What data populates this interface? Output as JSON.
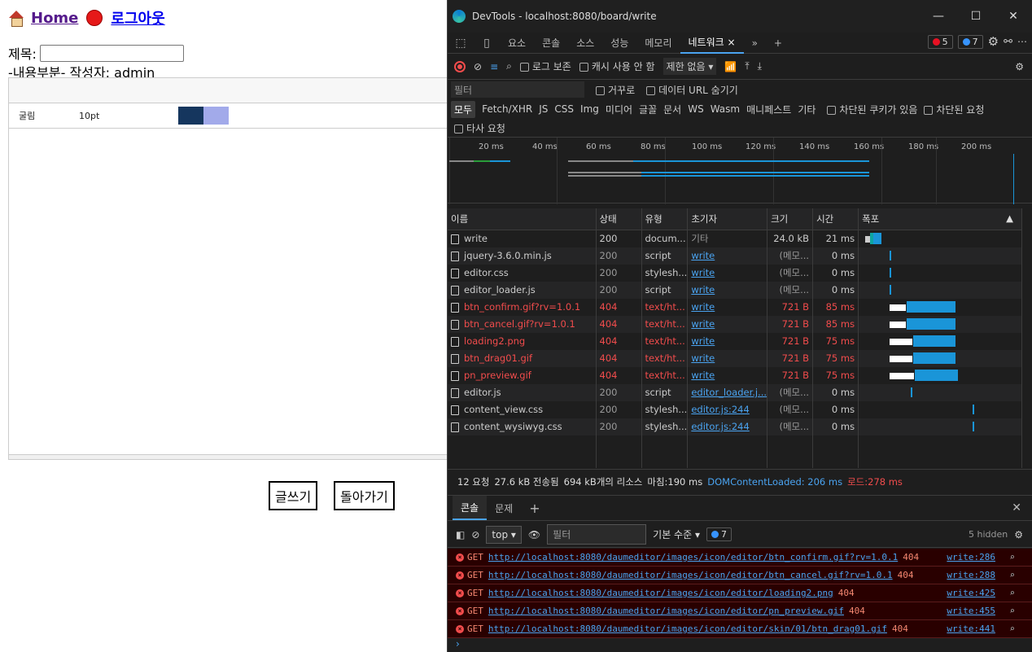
{
  "page": {
    "nav": {
      "home_label": "Home",
      "logout_label": "로그아웃"
    },
    "title_label": "제목:",
    "content_line": "-내용부분- 작성자: admin",
    "editor": {
      "font_name": "굴림",
      "font_size": "10pt"
    },
    "buttons": {
      "write": "글쓰기",
      "back": "돌아가기"
    }
  },
  "devtools": {
    "window_title": "DevTools - localhost:8080/board/write",
    "tabs": [
      "요소",
      "콘솔",
      "소스",
      "성능",
      "메모리",
      "네트워크"
    ],
    "badge_errors": "5",
    "badge_messages": "7",
    "toolbar": {
      "preserve_log": "로그 보존",
      "disable_cache": "캐시 사용 안 함",
      "throttle": "제한 없음"
    },
    "filter": {
      "placeholder": "필터",
      "invert": "거꾸로",
      "hide_data_urls": "데이터 URL 숨기기"
    },
    "type_filters": [
      "모두",
      "Fetch/XHR",
      "JS",
      "CSS",
      "Img",
      "미디어",
      "글꼴",
      "문서",
      "WS",
      "Wasm",
      "매니페스트",
      "기타"
    ],
    "blocked_cookies": "차단된 쿠키가 있음",
    "blocked_requests": "차단된 요청",
    "third_party": "타사 요청",
    "overview_ticks": [
      "20 ms",
      "40 ms",
      "60 ms",
      "80 ms",
      "100 ms",
      "120 ms",
      "140 ms",
      "160 ms",
      "180 ms",
      "200 ms"
    ],
    "columns": [
      "이름",
      "상태",
      "유형",
      "초기자",
      "크기",
      "시간",
      "폭포"
    ],
    "requests": [
      {
        "name": "write",
        "status": "200",
        "type": "docum...",
        "initiator": "기타",
        "size": "24.0 kB",
        "time": "21 ms",
        "error": false
      },
      {
        "name": "jquery-3.6.0.min.js",
        "status": "200",
        "type": "script",
        "initiator": "write",
        "size": "(메모...",
        "time": "0 ms",
        "error": false
      },
      {
        "name": "editor.css",
        "status": "200",
        "type": "stylesh...",
        "initiator": "write",
        "size": "(메모...",
        "time": "0 ms",
        "error": false
      },
      {
        "name": "editor_loader.js",
        "status": "200",
        "type": "script",
        "initiator": "write",
        "size": "(메모...",
        "time": "0 ms",
        "error": false
      },
      {
        "name": "btn_confirm.gif?rv=1.0.1",
        "status": "404",
        "type": "text/ht...",
        "initiator": "write",
        "size": "721 B",
        "time": "85 ms",
        "error": true
      },
      {
        "name": "btn_cancel.gif?rv=1.0.1",
        "status": "404",
        "type": "text/ht...",
        "initiator": "write",
        "size": "721 B",
        "time": "85 ms",
        "error": true
      },
      {
        "name": "loading2.png",
        "status": "404",
        "type": "text/ht...",
        "initiator": "write",
        "size": "721 B",
        "time": "75 ms",
        "error": true
      },
      {
        "name": "btn_drag01.gif",
        "status": "404",
        "type": "text/ht...",
        "initiator": "write",
        "size": "721 B",
        "time": "75 ms",
        "error": true
      },
      {
        "name": "pn_preview.gif",
        "status": "404",
        "type": "text/ht...",
        "initiator": "write",
        "size": "721 B",
        "time": "75 ms",
        "error": true
      },
      {
        "name": "editor.js",
        "status": "200",
        "type": "script",
        "initiator": "editor_loader.j...",
        "size": "(메모...",
        "time": "0 ms",
        "error": false
      },
      {
        "name": "content_view.css",
        "status": "200",
        "type": "stylesh...",
        "initiator": "editor.js:244",
        "size": "(메모...",
        "time": "0 ms",
        "error": false
      },
      {
        "name": "content_wysiwyg.css",
        "status": "200",
        "type": "stylesh...",
        "initiator": "editor.js:244",
        "size": "(메모...",
        "time": "0 ms",
        "error": false
      }
    ],
    "summary": {
      "requests": "12 요청",
      "transferred": "27.6 kB 전송됨",
      "resources": "694 kB개의 리소스",
      "finish": "마침:190 ms",
      "dcl": "DOMContentLoaded: 206 ms",
      "load": "로드:278 ms"
    },
    "drawer_tabs": [
      "콘솔",
      "문제"
    ],
    "console": {
      "context": "top",
      "filter_placeholder": "필터",
      "level": "기본 수준",
      "msg_count": "7",
      "hidden": "5 hidden"
    },
    "logs": [
      {
        "method": "GET",
        "url": "http://localhost:8080/daumeditor/images/icon/editor/btn_confirm.gif?rv=1.0.1",
        "code": "404",
        "source": "write:286"
      },
      {
        "method": "GET",
        "url": "http://localhost:8080/daumeditor/images/icon/editor/btn_cancel.gif?rv=1.0.1",
        "code": "404",
        "source": "write:288"
      },
      {
        "method": "GET",
        "url": "http://localhost:8080/daumeditor/images/icon/editor/loading2.png",
        "code": "404",
        "source": "write:425"
      },
      {
        "method": "GET",
        "url": "http://localhost:8080/daumeditor/images/icon/editor/pn_preview.gif",
        "code": "404",
        "source": "write:455"
      },
      {
        "method": "GET",
        "url": "http://localhost:8080/daumeditor/images/icon/editor/skin/01/btn_drag01.gif",
        "code": "404",
        "source": "write:441"
      }
    ]
  }
}
